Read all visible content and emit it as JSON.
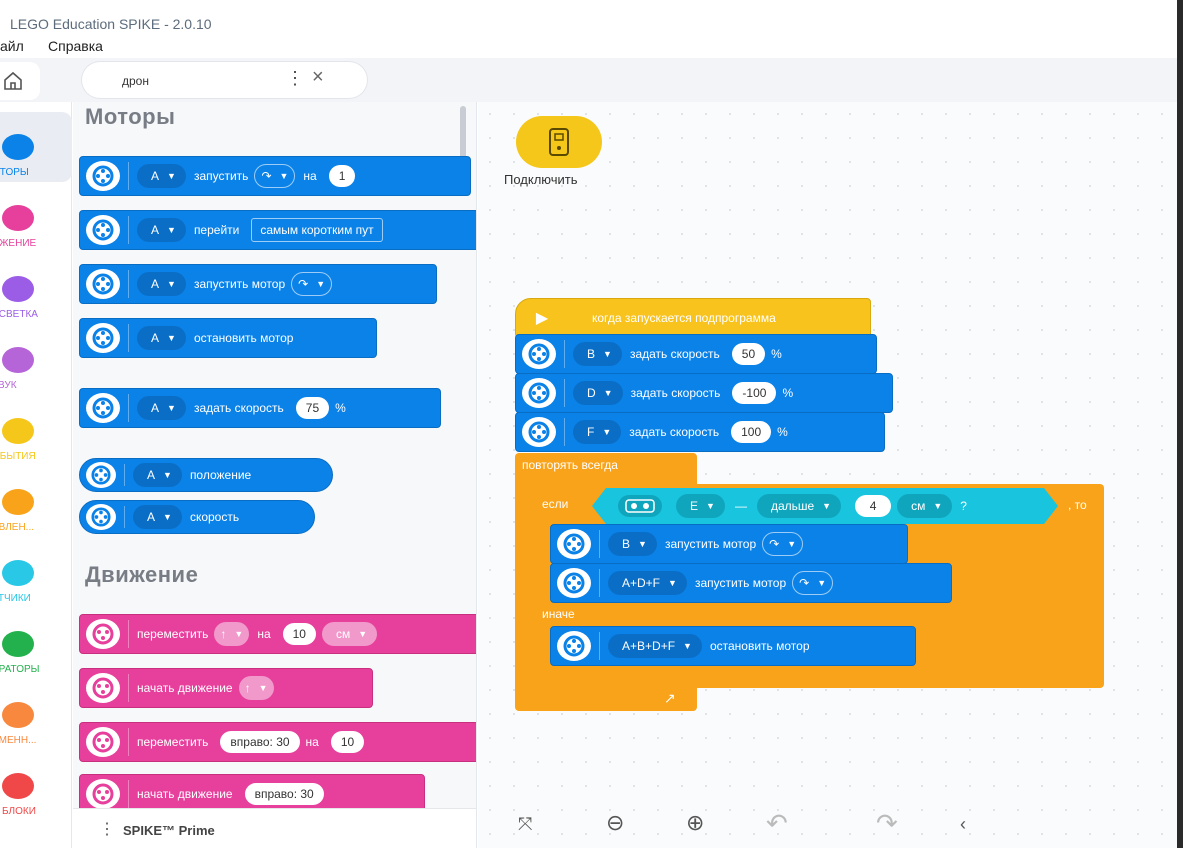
{
  "window": {
    "title": "LEGO Education SPIKE - 2.0.10"
  },
  "menu": {
    "file": "айл",
    "help": "Справка"
  },
  "tab": {
    "name": "дрон"
  },
  "categories": [
    {
      "label": "ОТОРЫ",
      "color": "#0b82e8"
    },
    {
      "label": "ИЖЕНИЕ",
      "color": "#e6409c"
    },
    {
      "label": "ДСВЕТКА",
      "color": "#9b5de5"
    },
    {
      "label": "ЗВУК",
      "color": "#b565d8"
    },
    {
      "label": "ОБЫТИЯ",
      "color": "#f5c71a"
    },
    {
      "label": "АВЛЕН...",
      "color": "#f9a31a"
    },
    {
      "label": "АТЧИКИ",
      "color": "#28c8e6"
    },
    {
      "label": "ЕРАТОРЫ",
      "color": "#22b14c"
    },
    {
      "label": "ЕМЕНН...",
      "color": "#f7883e"
    },
    {
      "label": "И БЛОКИ",
      "color": "#f04848"
    }
  ],
  "palette": {
    "motors_title": "Моторы",
    "motion_title": "Движение",
    "motor_blocks": {
      "b1": {
        "port": "A",
        "word1": "запустить",
        "word2": "на",
        "value": "1"
      },
      "b2": {
        "port": "A",
        "word1": "перейти",
        "option": "самым коротким пут"
      },
      "b3": {
        "port": "A",
        "word1": "запустить мотор"
      },
      "b4": {
        "port": "A",
        "word1": "остановить мотор"
      },
      "b5": {
        "port": "A",
        "word1": "задать скорость",
        "value": "75",
        "unit": "%"
      },
      "r1": {
        "port": "A",
        "word1": "положение"
      },
      "r2": {
        "port": "A",
        "word1": "скорость"
      }
    },
    "motion_blocks": {
      "m1": {
        "word1": "переместить",
        "word2": "на",
        "value": "10",
        "unit": "см"
      },
      "m2": {
        "word1": "начать движение"
      },
      "m3": {
        "word1": "переместить",
        "dir": "вправо: 30",
        "word2": "на",
        "value": "10"
      },
      "m4": {
        "word1": "начать движение",
        "dir": "вправо: 30"
      }
    },
    "footer": "SPIKE™ Prime"
  },
  "workspace": {
    "connect_label": "Подключить",
    "hat": "когда запускается подпрограмма",
    "speed_blocks": [
      {
        "port": "B",
        "label": "задать скорость",
        "value": "50",
        "unit": "%"
      },
      {
        "port": "D",
        "label": "задать скорость",
        "value": "-100",
        "unit": "%"
      },
      {
        "port": "F",
        "label": "задать скорость",
        "value": "100",
        "unit": "%"
      }
    ],
    "forever": "повторять всегда",
    "if": {
      "label": "если",
      "sensor_port": "E",
      "dash": "—",
      "compare": "дальше",
      "value": "4",
      "unit": "см",
      "q": "?",
      "then": ", то"
    },
    "then_blocks": [
      {
        "port": "B",
        "label": "запустить мотор"
      },
      {
        "port": "A+D+F",
        "label": "запустить мотор"
      }
    ],
    "else": "иначе",
    "else_block": {
      "port": "A+B+D+F",
      "label": "остановить мотор"
    }
  }
}
